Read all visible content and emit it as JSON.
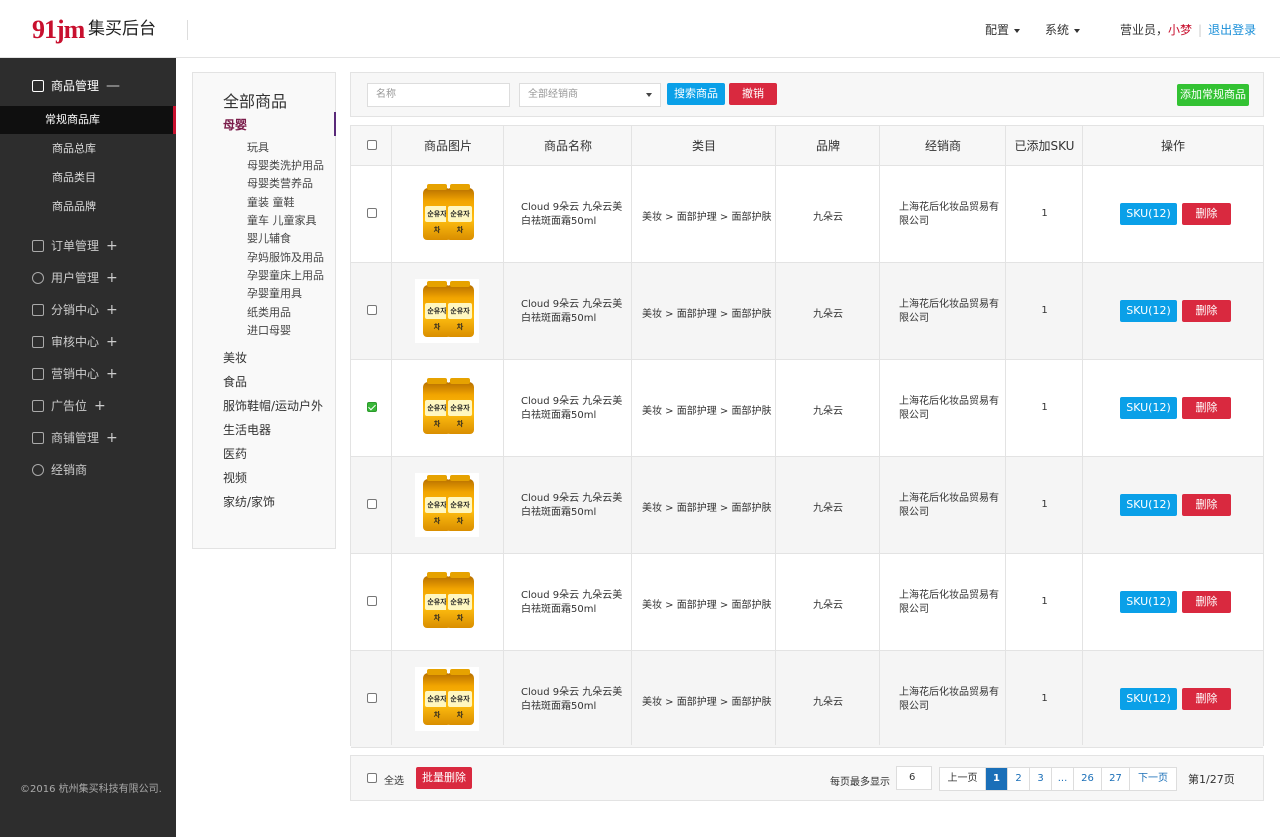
{
  "header": {
    "logo": "91jm",
    "brand": "集买后台",
    "menus": [
      {
        "label": "配置"
      },
      {
        "label": "系统"
      }
    ],
    "user_role": "营业员，",
    "user_name": "小梦",
    "logout": "退出登录"
  },
  "sidebar": {
    "groups": [
      {
        "label": "商品管理",
        "toggle": "—",
        "icon": "bag-icon",
        "active": true
      },
      {
        "label": "订单管理",
        "toggle": "+",
        "icon": "order-icon"
      },
      {
        "label": "用户管理",
        "toggle": "+",
        "icon": "user-icon"
      },
      {
        "label": "分销中心",
        "toggle": "+",
        "icon": "distribution-icon"
      },
      {
        "label": "审核中心",
        "toggle": "+",
        "icon": "audit-icon"
      },
      {
        "label": "营销中心",
        "toggle": "+",
        "icon": "marketing-icon"
      },
      {
        "label": "广告位",
        "toggle": "+",
        "icon": "ad-icon"
      },
      {
        "label": "商铺管理",
        "toggle": "+",
        "icon": "shop-icon"
      },
      {
        "label": "经销商",
        "toggle": "",
        "icon": "dealer-icon"
      }
    ],
    "sub_items": [
      {
        "label": "常规商品库",
        "active": true
      },
      {
        "label": "商品总库"
      },
      {
        "label": "商品类目"
      },
      {
        "label": "商品品牌"
      }
    ],
    "copyright": "©2016 杭州集买科技有限公司."
  },
  "categories": {
    "title": "全部商品",
    "active": "母婴",
    "sub": [
      "玩具",
      "母婴类洗护用品",
      "母婴类营养品",
      "童装 童鞋",
      "童车 儿童家具",
      "婴儿辅食",
      "孕妈服饰及用品",
      "孕婴童床上用品",
      "孕婴童用具",
      "纸类用品",
      "进口母婴"
    ],
    "top": [
      "美妆",
      "食品",
      "服饰鞋帽/运动户外",
      "生活电器",
      "医药",
      "视频",
      "家纺/家饰"
    ]
  },
  "toolbar": {
    "name_placeholder": "名称",
    "dealer_select": "全部经销商",
    "search_button": "搜索商品",
    "cancel_button": "撤销",
    "add_button": "添加常规商品"
  },
  "table": {
    "headers": [
      "商品图片",
      "商品名称",
      "类目",
      "品牌",
      "经销商",
      "已添加SKU",
      "操作"
    ],
    "rows": [
      {
        "name": "Cloud 9朵云 九朵云美白祛斑面霜50ml",
        "category": "美妆 > 面部护理 > 面部护肤",
        "brand": "九朵云",
        "dealer": "上海花后化妆品贸易有限公司",
        "sku": "1",
        "sku_button": "SKU(12)",
        "delete_button": "删除",
        "checked": false,
        "jar_label": "순유자차"
      },
      {
        "name": "Cloud 9朵云 九朵云美白祛斑面霜50ml",
        "category": "美妆 > 面部护理 > 面部护肤",
        "brand": "九朵云",
        "dealer": "上海花后化妆品贸易有限公司",
        "sku": "1",
        "sku_button": "SKU(12)",
        "delete_button": "删除",
        "checked": false,
        "jar_label": "순유자차"
      },
      {
        "name": "Cloud 9朵云 九朵云美白祛斑面霜50ml",
        "category": "美妆 > 面部护理 > 面部护肤",
        "brand": "九朵云",
        "dealer": "上海花后化妆品贸易有限公司",
        "sku": "1",
        "sku_button": "SKU(12)",
        "delete_button": "删除",
        "checked": true,
        "jar_label": "순유자차"
      },
      {
        "name": "Cloud 9朵云 九朵云美白祛斑面霜50ml",
        "category": "美妆 > 面部护理 > 面部护肤",
        "brand": "九朵云",
        "dealer": "上海花后化妆品贸易有限公司",
        "sku": "1",
        "sku_button": "SKU(12)",
        "delete_button": "删除",
        "checked": false,
        "jar_label": "순유자차"
      },
      {
        "name": "Cloud 9朵云 九朵云美白祛斑面霜50ml",
        "category": "美妆 > 面部护理 > 面部护肤",
        "brand": "九朵云",
        "dealer": "上海花后化妆品贸易有限公司",
        "sku": "1",
        "sku_button": "SKU(12)",
        "delete_button": "删除",
        "checked": false,
        "jar_label": "순유자차"
      },
      {
        "name": "Cloud 9朵云 九朵云美白祛斑面霜50ml",
        "category": "美妆 > 面部护理 > 面部护肤",
        "brand": "九朵云",
        "dealer": "上海花后化妆品贸易有限公司",
        "sku": "1",
        "sku_button": "SKU(12)",
        "delete_button": "删除",
        "checked": false,
        "jar_label": "순유자차"
      }
    ]
  },
  "footer": {
    "select_all": "全选",
    "batch_delete": "批量删除",
    "per_page_label": "每页最多显示",
    "per_page_value": "6",
    "pages": [
      {
        "label": "上一页",
        "kind": "prev"
      },
      {
        "label": "1",
        "kind": "page",
        "active": true
      },
      {
        "label": "2",
        "kind": "page"
      },
      {
        "label": "3",
        "kind": "page"
      },
      {
        "label": "...",
        "kind": "ellipsis"
      },
      {
        "label": "26",
        "kind": "page"
      },
      {
        "label": "27",
        "kind": "page"
      },
      {
        "label": "下一页",
        "kind": "next"
      }
    ],
    "page_total": "第1/27页"
  },
  "colors": {
    "brand_red": "#c8102e",
    "primary_blue": "#0aa0e8",
    "danger_red": "#d9293f",
    "success_green": "#33c233",
    "sidebar_bg": "#2d2d2d"
  }
}
